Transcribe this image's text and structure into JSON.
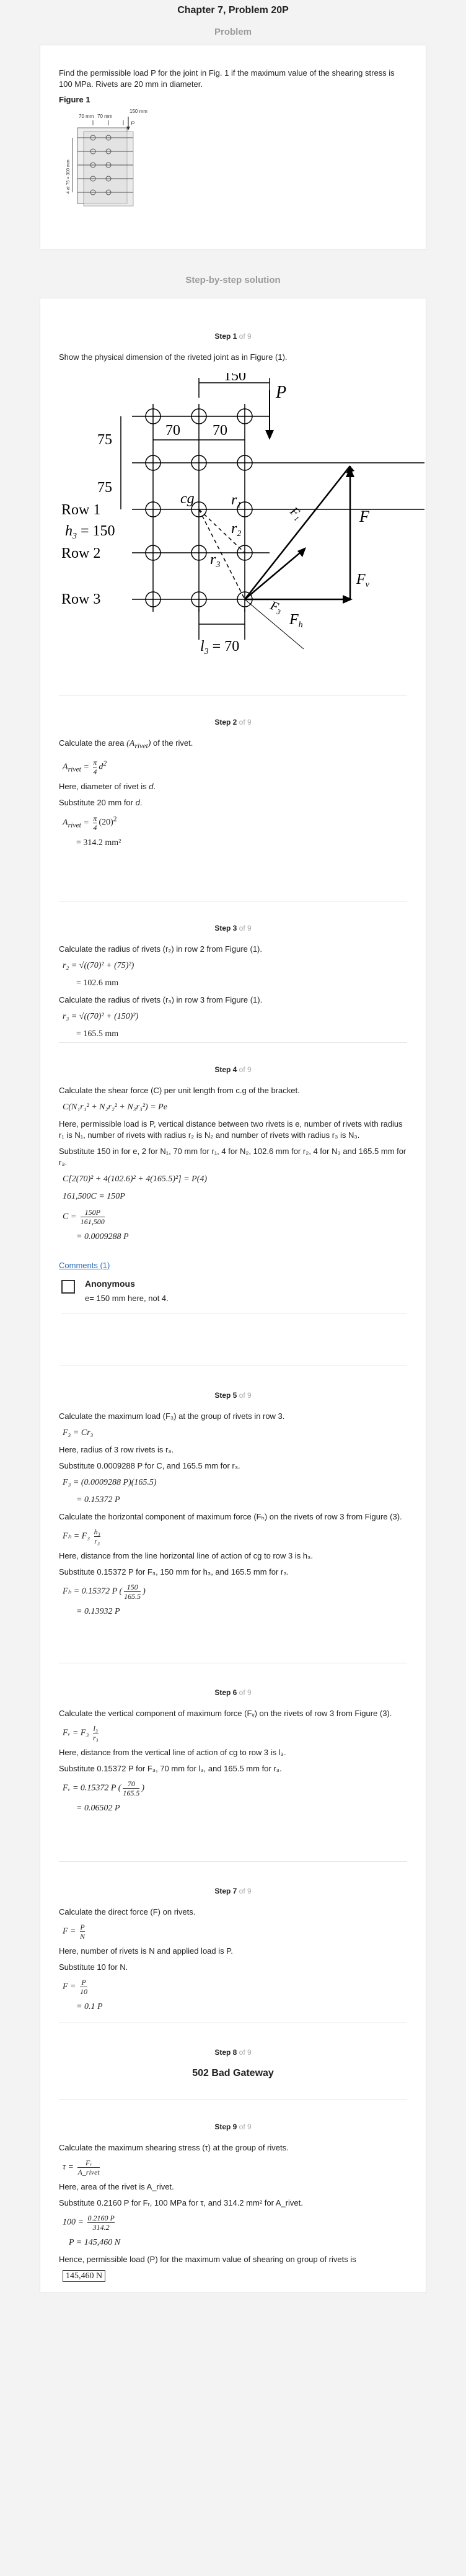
{
  "header": {
    "title": "Chapter 7, Problem 20P",
    "problem_label": "Problem"
  },
  "problem": {
    "text": "Find the permissible load P for the joint in Fig. 1 if the maximum value of the shearing stress is 100 MPa. Rivets are 20 mm in diameter.",
    "figure_label": "Figure 1",
    "fig_dim_a": "70 mm",
    "fig_dim_b": "70 mm",
    "fig_dim_c": "150 mm",
    "fig_dim_side": "4 at 75 = 300 mm",
    "fig_p": "P"
  },
  "solution_title": "Step-by-step solution",
  "steps": {
    "total": "of 9",
    "s1": {
      "label": "Step 1",
      "text": "Show the physical dimension of the riveted joint as in Figure (1).",
      "fig": {
        "d150": "150",
        "dP": "P",
        "d70a": "70",
        "d70b": "70",
        "d75a": "75",
        "d75b": "75",
        "cg": "cg",
        "r1": "r",
        "r1s": "1",
        "r2": "r",
        "r2s": "2",
        "r3": "r",
        "r3s": "3",
        "row1": "Row 1",
        "row2": "Row 2",
        "row3": "Row 3",
        "h3": "h",
        "h3s": "3",
        "h3v": " = 150",
        "l3": "l",
        "l3s": "3",
        "l3v": " = 70",
        "F": "F",
        "Fv": "F",
        "Fvs": "v",
        "Fh": "F",
        "Fhs": "h",
        "F1": "F",
        "F1s": "1",
        "F3": "F",
        "F3s": "3"
      }
    },
    "s2": {
      "label": "Step 2",
      "l1": "Calculate the area",
      "l1b": "of the rivet.",
      "l2": "Here, diameter of rivet is",
      "l2b": "d",
      "l3": "Substitute",
      "l3b": "20 mm",
      "l3c": "for",
      "l3d": "d",
      "res": "= 314.2 mm²"
    },
    "s3": {
      "label": "Step 3",
      "l1": "Calculate the radius of rivets (r₂) in row 2 from Figure (1).",
      "eq1": "r₂ = √((70)² + (75)²)",
      "res1": "= 102.6 mm",
      "l2": "Calculate the radius of rivets (r₃) in row 3 from Figure (1).",
      "eq2": "r₃ = √((70)² + (150)²)",
      "res2": "= 165.5 mm"
    },
    "s4": {
      "label": "Step 4",
      "l1": "Calculate the shear force (C) per unit length from c.g of the bracket.",
      "eq1": "C(N₁r₁² + N₂r₂² + N₃r₃²) = Pe",
      "l2": "Here, permissible load is P, vertical distance between two rivets is e, number of rivets with radius r₁ is N₁, number of rivets with radius r₂ is N₂ and number of rivets with radius r₃ is N₃.",
      "l3": "Substitute 150 in for e, 2 for N₁, 70 mm for r₁, 4 for N₂, 102.6 mm for r₂, 4 for N₃ and 165.5 mm for r₃.",
      "eq2": "C[2(70)² + 4(102.6)² + 4(165.5)²] = P(4)",
      "eq3": "161,500C = 150P",
      "eq4l": "C =",
      "eq4n": "150P",
      "eq4d": "161,500",
      "res": "= 0.0009288 P",
      "comments": "Comments (1)",
      "comment_name": "Anonymous",
      "comment_text": "e= 150 mm here, not 4."
    },
    "s5": {
      "label": "Step 5",
      "l1": "Calculate the maximum load (F₃) at the group of rivets in row 3.",
      "eq1": "F₃ = Cr₃",
      "l2": "Here, radius of 3 row rivets is r₃.",
      "l3": "Substitute 0.0009288 P for C, and 165.5 mm for r₃.",
      "eq2": "F₃ = (0.0009288 P)(165.5)",
      "res1": "= 0.15372 P",
      "l4": "Calculate the horizontal component of maximum force (Fₕ) on the rivets of row 3 from Figure (3).",
      "eq3l": "Fₕ = F₃",
      "eq3n": "h₃",
      "eq3d": "r₃",
      "l5": "Here, distance from the line horizontal line of action of cg to row 3 is h₃.",
      "l6": "Substitute 0.15372 P for F₃, 150 mm for h₃, and 165.5 mm for r₃.",
      "eq4l": "Fₕ = 0.15372 P",
      "eq4n": "150",
      "eq4d": "165.5",
      "res2": "= 0.13932 P"
    },
    "s6": {
      "label": "Step 6",
      "l1": "Calculate the vertical component of maximum force (Fᵥ) on the rivets of row 3 from Figure (3).",
      "eq1l": "Fᵥ = F₃",
      "eq1n": "l₃",
      "eq1d": "r₃",
      "l2": "Here, distance from the vertical line of action of cg to row 3 is l₃.",
      "l3": "Substitute 0.15372 P for F₃, 70 mm for l₃, and 165.5 mm for r₃.",
      "eq2l": "Fᵥ = 0.15372 P",
      "eq2n": "70",
      "eq2d": "165.5",
      "res": "= 0.06502 P"
    },
    "s7": {
      "label": "Step 7",
      "l1": "Calculate the direct force (F) on rivets.",
      "eq1l": "F =",
      "eq1n": "P",
      "eq1d": "N",
      "l2": "Here, number of rivets is N and applied load is P.",
      "l3": "Substitute 10 for N.",
      "eq2l": "F =",
      "eq2n": "P",
      "eq2d": "10",
      "res": "= 0.1 P"
    },
    "s8": {
      "label": "Step 8",
      "error": "502 Bad Gateway"
    },
    "s9": {
      "label": "Step 9",
      "l1": "Calculate the maximum shearing stress (τ) at the group of rivets.",
      "eq1l": "τ =",
      "eq1n": "Fᵣ",
      "eq1d": "A_rivet",
      "l2": "Here, area of the rivet is A_rivet.",
      "l3": "Substitute 0.2160 P for Fᵣ, 100 MPa for τ, and 314.2 mm² for A_rivet.",
      "eq2l": "100 =",
      "eq2n": "0.2160 P",
      "eq2d": "314.2",
      "eq3": "P = 145,460 N",
      "l4": "Hence, permissible load (P) for the maximum value of shearing on group of rivets is",
      "final": "145,460 N"
    }
  }
}
